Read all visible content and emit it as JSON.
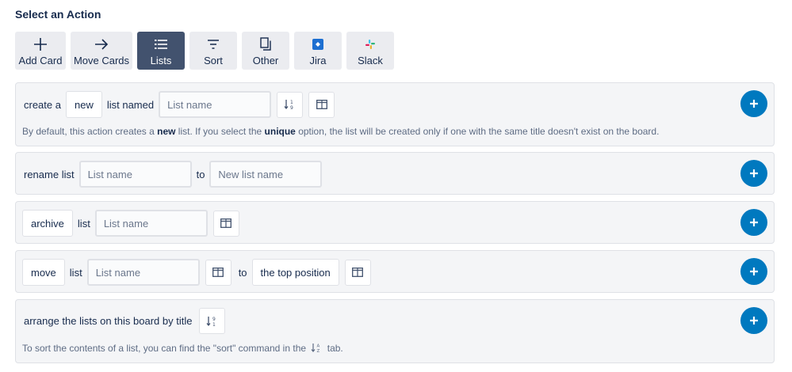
{
  "heading": "Select an Action",
  "tabs": [
    {
      "label": "Add Card",
      "icon": "plus-icon",
      "active": false
    },
    {
      "label": "Move Cards",
      "icon": "arrow-right-icon",
      "active": false
    },
    {
      "label": "Lists",
      "icon": "list-icon",
      "active": true
    },
    {
      "label": "Sort",
      "icon": "sort-icon",
      "active": false
    },
    {
      "label": "Other",
      "icon": "copy-icon",
      "active": false
    },
    {
      "label": "Jira",
      "icon": "jira-logo-icon",
      "active": false
    },
    {
      "label": "Slack",
      "icon": "slack-logo-icon",
      "active": false
    }
  ],
  "create_row": {
    "prefix": "create a",
    "mode": "new",
    "middle": "list named",
    "name_placeholder": "List name",
    "desc_before": "By default, this action creates a",
    "desc_bold1": "new",
    "desc_mid": "list. If you select the",
    "desc_bold2": "unique",
    "desc_after": "option, the list will be created only if one with the same title doesn't exist on the board."
  },
  "rename_row": {
    "prefix": "rename list",
    "from_placeholder": "List name",
    "to": "to",
    "to_placeholder": "New list name"
  },
  "archive_row": {
    "action": "archive",
    "word": "list",
    "name_placeholder": "List name"
  },
  "move_row": {
    "action": "move",
    "word": "list",
    "name_placeholder": "List name",
    "to": "to",
    "position": "the top position"
  },
  "arrange_row": {
    "text": "arrange the lists on this board by title",
    "desc_before": "To sort the contents of a list, you can find the \"sort\" command in the",
    "desc_after": "tab."
  },
  "colors": {
    "accent": "#0079bf",
    "active_tab": "#42526e",
    "tab_bg": "#ebecf0",
    "row_bg": "#f4f5f7"
  }
}
